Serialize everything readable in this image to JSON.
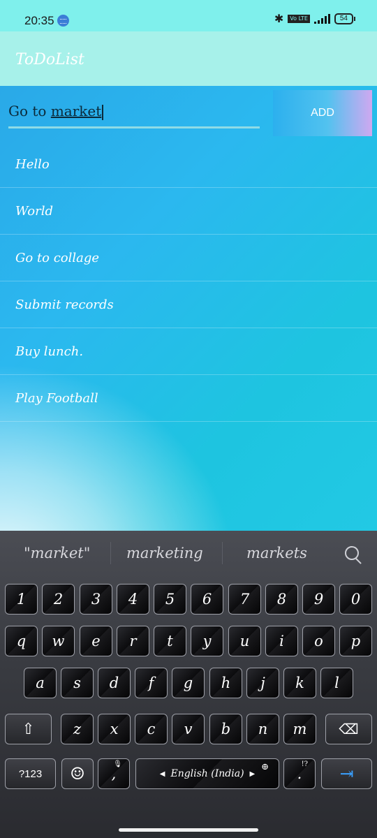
{
  "status": {
    "time": "20:35",
    "volte": "Vo LTE",
    "battery": "54"
  },
  "app": {
    "title": "ToDoList"
  },
  "input": {
    "prefix": "Go to ",
    "underlined": "market",
    "add_label": "ADD"
  },
  "tasks": [
    "Hello",
    "World",
    "Go to collage",
    "Submit records",
    "Buy lunch.",
    "Play Football"
  ],
  "keyboard": {
    "suggestions": [
      "\"market\"",
      "marketing",
      "markets"
    ],
    "row_numbers": [
      "1",
      "2",
      "3",
      "4",
      "5",
      "6",
      "7",
      "8",
      "9",
      "0"
    ],
    "row1": [
      "q",
      "w",
      "e",
      "r",
      "t",
      "y",
      "u",
      "i",
      "o",
      "p"
    ],
    "row2": [
      "a",
      "s",
      "d",
      "f",
      "g",
      "h",
      "j",
      "k",
      "l"
    ],
    "row3": [
      "z",
      "x",
      "c",
      "v",
      "b",
      "n",
      "m"
    ],
    "symbols_label": "?123",
    "comma": ",",
    "space_label": "English (India)",
    "period": ".",
    "period_alt": "!?",
    "icons": {
      "shift": "shift-icon",
      "backspace": "backspace-icon",
      "emoji": "emoji-icon",
      "mic": "mic-icon",
      "globe": "globe-icon",
      "enter": "next-icon",
      "search": "search-icon"
    }
  }
}
